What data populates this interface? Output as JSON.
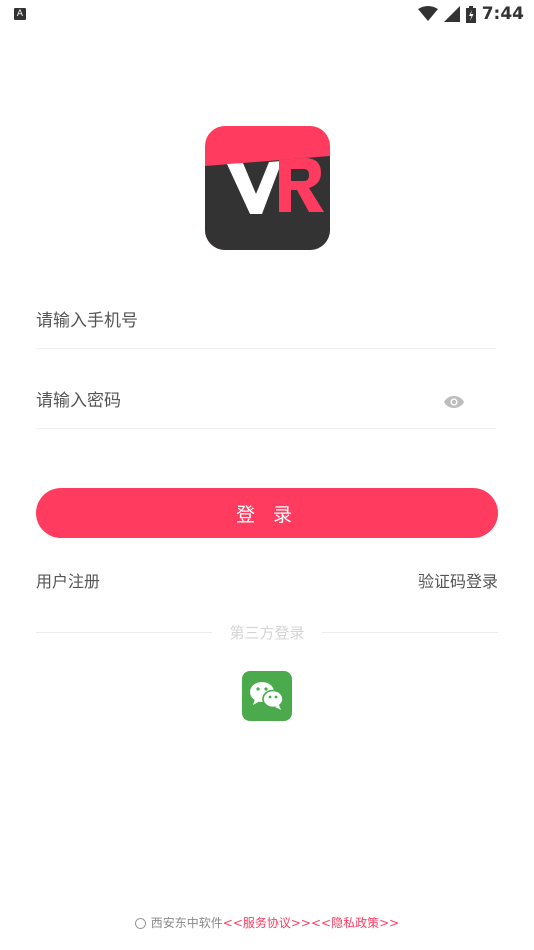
{
  "status_bar": {
    "left_icon_letter": "A",
    "time": "7:44",
    "icons": [
      "wifi-icon",
      "signal-icon",
      "battery-charging-icon"
    ]
  },
  "logo": {
    "text": "VR",
    "colors": {
      "top": "#ff3c5f",
      "bottom": "#333333"
    }
  },
  "form": {
    "phone_placeholder": "请输入手机号",
    "password_placeholder": "请输入密码",
    "password_toggle_icon": "eye-icon",
    "login_label": "登 录"
  },
  "links": {
    "register": "用户注册",
    "code_login": "验证码登录"
  },
  "third_party": {
    "label": "第三方登录",
    "icons": [
      "wechat-icon"
    ]
  },
  "footer": {
    "company": "西安东中软件",
    "service_agreement": "<<服务协议>>",
    "privacy_policy": "<<隐私政策>>"
  },
  "colors": {
    "accent": "#ff3c5f",
    "wechat_green": "#4aaa4c",
    "text": "#555555"
  }
}
